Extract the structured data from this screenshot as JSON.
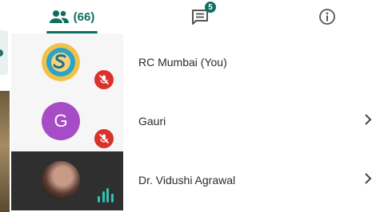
{
  "tabs": {
    "people": {
      "icon": "people-icon",
      "count_label": "(66)"
    },
    "chat": {
      "icon": "chat-icon",
      "badge": "5"
    },
    "info": {
      "icon": "info-icon"
    }
  },
  "participants": [
    {
      "name": "RC Mumbai (You)",
      "avatar": "logo",
      "mic": "muted",
      "has_chevron": false
    },
    {
      "name": "Gauri",
      "avatar_initial": "G",
      "avatar_color": "#a64cc6",
      "mic": "muted",
      "has_chevron": true
    },
    {
      "name": "Dr. Vidushi Agrawal",
      "avatar": "photo",
      "mic": "speaking",
      "has_chevron": true
    }
  ],
  "colors": {
    "accent": "#0f6e62",
    "mute": "#d9312b",
    "speaking": "#2ec4b2"
  }
}
